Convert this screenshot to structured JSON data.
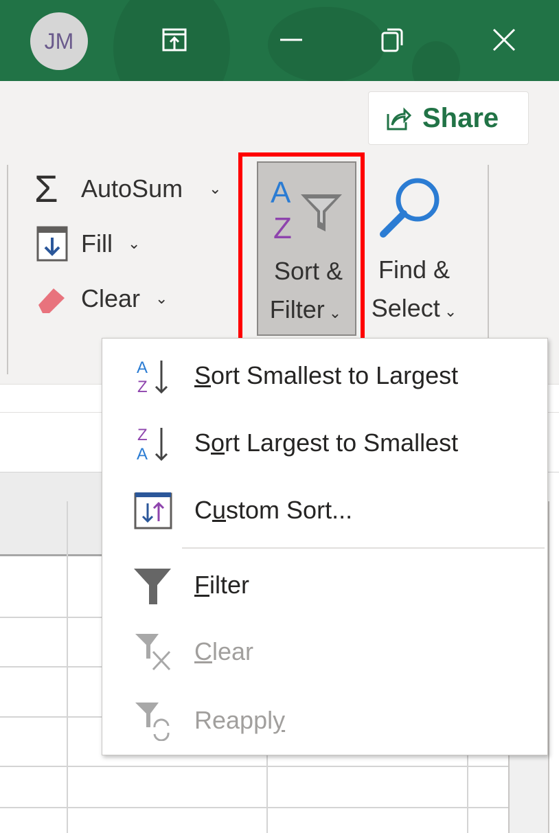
{
  "titlebar": {
    "avatar_initials": "JM",
    "color": "#217346"
  },
  "ribbon": {
    "share_label": "Share",
    "autosum_label": "AutoSum",
    "fill_label": "Fill",
    "clear_label": "Clear",
    "sort_filter_line1": "Sort &",
    "sort_filter_line2": "Filter",
    "find_select_line1": "Find &",
    "find_select_line2": "Select"
  },
  "highlight_color": "#ff0000",
  "menu": {
    "items": [
      {
        "label": "Sort Smallest to Largest",
        "access_key_index": 0,
        "icon": "sort-a-to-z-icon",
        "enabled": true
      },
      {
        "label": "Sort Largest to Smallest",
        "access_key_index": 1,
        "icon": "sort-z-to-a-icon",
        "enabled": true
      },
      {
        "label": "Custom Sort...",
        "access_key_index": 1,
        "icon": "custom-sort-icon",
        "enabled": true
      },
      {
        "label": "Filter",
        "access_key_index": 0,
        "icon": "filter-icon",
        "enabled": true
      },
      {
        "label": "Clear",
        "access_key_index": 0,
        "icon": "clear-filter-icon",
        "enabled": false
      },
      {
        "label": "Reapply",
        "access_key_index": 6,
        "icon": "reapply-filter-icon",
        "enabled": false
      }
    ]
  }
}
